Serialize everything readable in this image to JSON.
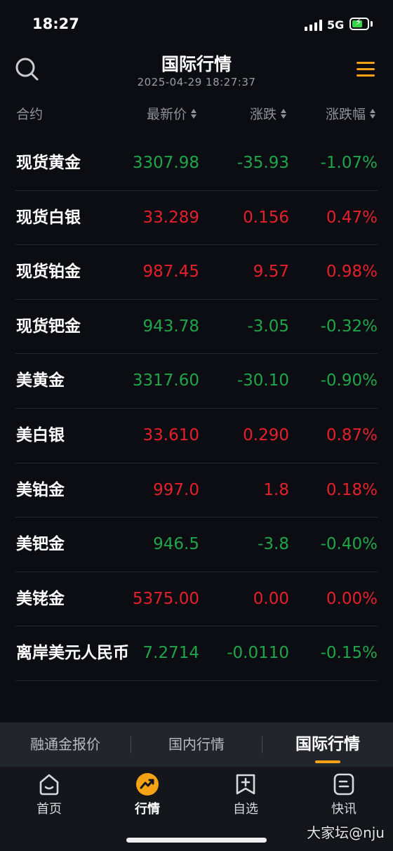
{
  "status_bar": {
    "time": "18:27",
    "network": "5G"
  },
  "header": {
    "title": "国际行情",
    "subtitle": "2025-04-29 18:27:37"
  },
  "columns": {
    "name": "合约",
    "price": "最新价",
    "change": "涨跌",
    "pct": "涨跌幅"
  },
  "colors": {
    "up": "#e4202b",
    "down": "#1fa54a",
    "accent": "#f5a215"
  },
  "quotes": [
    {
      "name": "现货黄金",
      "price": "3307.98",
      "change": "-35.93",
      "pct": "-1.07%",
      "trend": "down"
    },
    {
      "name": "现货白银",
      "price": "33.289",
      "change": "0.156",
      "pct": "0.47%",
      "trend": "up"
    },
    {
      "name": "现货铂金",
      "price": "987.45",
      "change": "9.57",
      "pct": "0.98%",
      "trend": "up"
    },
    {
      "name": "现货钯金",
      "price": "943.78",
      "change": "-3.05",
      "pct": "-0.32%",
      "trend": "down"
    },
    {
      "name": "美黄金",
      "price": "3317.60",
      "change": "-30.10",
      "pct": "-0.90%",
      "trend": "down"
    },
    {
      "name": "美白银",
      "price": "33.610",
      "change": "0.290",
      "pct": "0.87%",
      "trend": "up"
    },
    {
      "name": "美铂金",
      "price": "997.0",
      "change": "1.8",
      "pct": "0.18%",
      "trend": "up"
    },
    {
      "name": "美钯金",
      "price": "946.5",
      "change": "-3.8",
      "pct": "-0.40%",
      "trend": "down"
    },
    {
      "name": "美铑金",
      "price": "5375.00",
      "change": "0.00",
      "pct": "0.00%",
      "trend": "up"
    },
    {
      "name": "离岸美元人民币",
      "price": "7.2714",
      "change": "-0.0110",
      "pct": "-0.15%",
      "trend": "down"
    }
  ],
  "market_tabs": [
    {
      "label": "融通金报价"
    },
    {
      "label": "国内行情"
    },
    {
      "label": "国际行情",
      "active": true
    }
  ],
  "bottom_nav": [
    {
      "label": "首页",
      "icon": "home-icon"
    },
    {
      "label": "行情",
      "icon": "market-trend-icon",
      "active": true
    },
    {
      "label": "自选",
      "icon": "watchlist-add-icon"
    },
    {
      "label": "快讯",
      "icon": "news-icon"
    }
  ],
  "watermark": "大家坛@nju"
}
